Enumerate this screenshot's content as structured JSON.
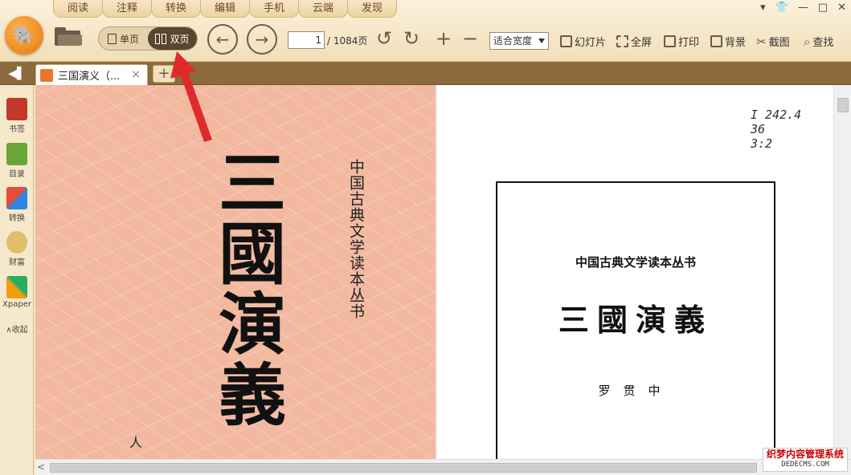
{
  "menu_tabs": [
    "阅读",
    "注释",
    "转换",
    "编辑",
    "手机",
    "云端",
    "发现"
  ],
  "window_controls": {
    "menu": "▾",
    "skin": "👕",
    "minimize": "—",
    "maximize": "□",
    "close": "✕"
  },
  "toolbar": {
    "single_page_label": "单页",
    "double_page_label": "双页",
    "current_page": "1",
    "total_pages": "/ 1084页",
    "zoom_value": "适合宽度",
    "slideshow_label": "幻灯片",
    "fullscreen_label": "全屏",
    "print_label": "打印",
    "background_label": "背景",
    "screenshot_label": "截图",
    "search_label": "查找"
  },
  "tabs": {
    "doc_title": "三国演义（...",
    "close": "×",
    "add": "+"
  },
  "sidebar": {
    "items": [
      {
        "label": "书签",
        "icon": "bookmark-icon",
        "color": "#c0392b"
      },
      {
        "label": "目录",
        "icon": "toc-icon",
        "color": "#6aa53a"
      },
      {
        "label": "转换",
        "icon": "convert-icon",
        "color": "#e74c3c"
      },
      {
        "label": "财富",
        "icon": "wealth-icon",
        "color": "#c9a24a"
      },
      {
        "label": "Xpaper",
        "icon": "xpaper-icon",
        "color": "#3aa55b"
      }
    ],
    "collapse_label": "∧收起"
  },
  "left_page": {
    "big_title": "三國演義",
    "series": "中国古典文学读本丛书",
    "person_char": "人"
  },
  "right_page": {
    "library_mark": "I 242.4\n36\n3:2",
    "series": "中国古典文学读本丛书",
    "title": "三國演義",
    "author": "罗贯中"
  },
  "watermark": {
    "line1": "织梦内容管理系统",
    "line2": "DEDECMS.COM"
  }
}
